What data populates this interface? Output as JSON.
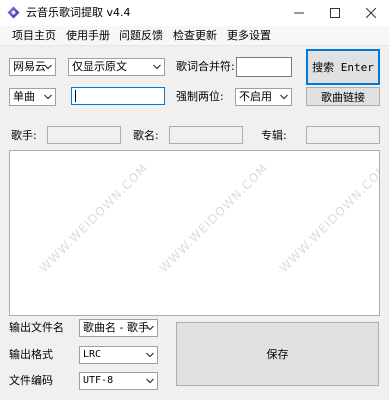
{
  "window": {
    "title": "云音乐歌词提取 v4.4",
    "minimize_icon": "minimize-icon",
    "maximize_icon": "maximize-icon",
    "close_icon": "close-icon"
  },
  "menu": {
    "items": [
      {
        "label": "项目主页"
      },
      {
        "label": "使用手册"
      },
      {
        "label": "问题反馈"
      },
      {
        "label": "检查更新"
      },
      {
        "label": "更多设置"
      }
    ]
  },
  "row1": {
    "source_select": "网易云",
    "display_select": "仅显示原文",
    "merge_label": "歌词合并符:",
    "merge_value": "",
    "search_button": "搜索 Enter"
  },
  "row2": {
    "mode_select": "单曲",
    "id_value": "",
    "force_label": "强制两位:",
    "force_select": "不启用",
    "link_button": "歌曲链接"
  },
  "row3": {
    "singer_label": "歌手:",
    "singer_value": "",
    "song_label": "歌名:",
    "song_value": "",
    "album_label": "专辑:",
    "album_value": ""
  },
  "watermark": "WWW.WEIDOWN.COM",
  "bottom": {
    "filename_label": "输出文件名",
    "filename_select": "歌曲名 - 歌手",
    "format_label": "输出格式",
    "format_select": "LRC",
    "encoding_label": "文件编码",
    "encoding_select": "UTF-8",
    "save_button": "保存"
  },
  "colors": {
    "accent": "#0078d7",
    "client_bg": "#f0f0f0",
    "button_bg": "#e1e1e1"
  }
}
